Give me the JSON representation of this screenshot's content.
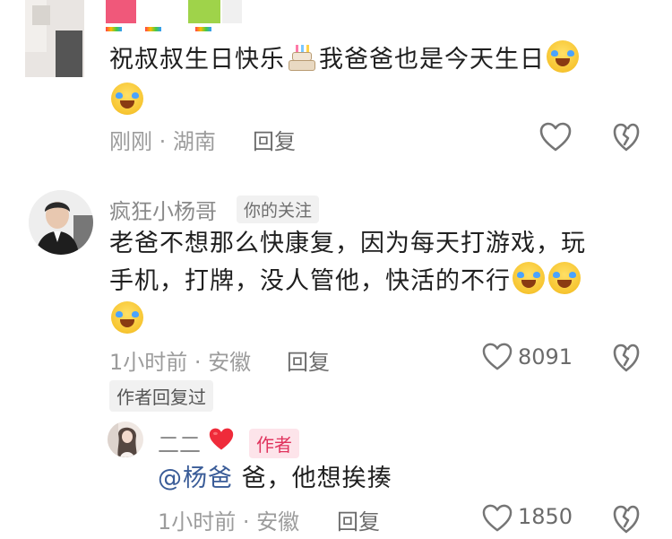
{
  "comment1": {
    "text_a": "祝叔叔生日快乐",
    "text_b": "我爸爸也是今天生日",
    "emoji_cake": "birthday-cake-emoji",
    "emoji_laugh": "laugh-cry-emoji",
    "meta": "刚刚 · 湖南",
    "reply_label": "回复"
  },
  "comment2": {
    "username": "疯狂小杨哥",
    "follow_tag": "你的关注",
    "line1": "老爸不想那么快康复，因为每天打游戏，玩",
    "line2": "手机，打牌，没人管他，快活的不行",
    "meta": "1小时前 · 安徽",
    "reply_label": "回复",
    "like_count": "8091",
    "author_replied_tag": "作者回复过"
  },
  "reply1": {
    "username": "二二",
    "author_tag": "作者",
    "mention": "@杨爸",
    "text": "爸，他想挨揍",
    "meta": "1小时前 · 安徽",
    "reply_label": "回复",
    "like_count": "1850"
  },
  "colors": {
    "author_tag_text": "#e0345e",
    "mention": "#3a5c98",
    "heart_red": "#ef2b3a"
  }
}
